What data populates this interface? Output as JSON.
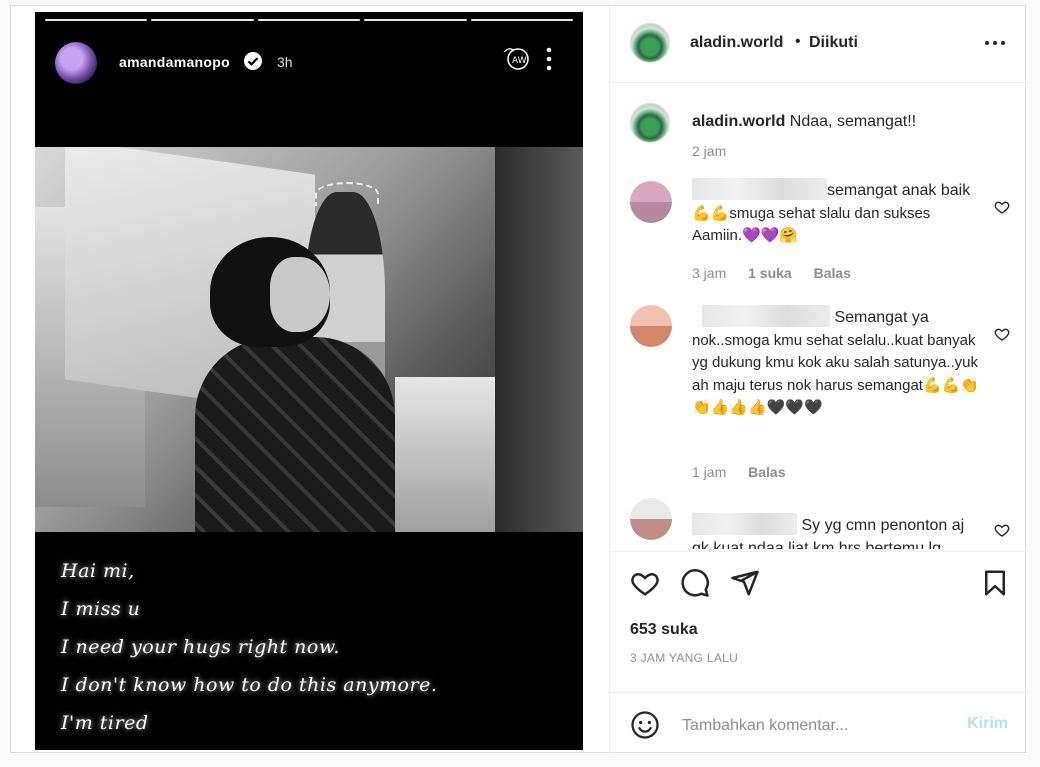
{
  "story": {
    "username": "amandamanopo",
    "time": "3h",
    "progress_segments": 5,
    "message_lines": [
      "Hai mi,",
      "I miss u",
      "I need your hugs right now.",
      "I don't know how to do this anymore.",
      "I'm tired"
    ]
  },
  "header": {
    "username": "aladin.world",
    "dot": "•",
    "follow_status": "Diikuti"
  },
  "caption": {
    "username": "aladin.world",
    "text": "Ndaa, semangat!!",
    "time": "2 jam"
  },
  "comments": [
    {
      "text_line1": "semangat anak baik",
      "text_rest": "💪💪smuga sehat slalu dan sukses Aamiin.💜💜🤗",
      "time": "3 jam",
      "likes": "1 suka",
      "reply": "Balas"
    },
    {
      "text_line1": "Semangat ya",
      "text_rest": "nok..smoga kmu sehat selalu..kuat banyak yg dukung kmu kok aku salah satunya..yuk ah maju terus nok harus semangat💪💪👏👏👍👍👍🖤🖤🖤",
      "time": "1 jam",
      "reply": "Balas"
    },
    {
      "text_line1": "Sy yg cmn penonton aj",
      "text_rest": "gk kuat ndaa liat km hrs bertemu lg"
    }
  ],
  "likes_count": "653 suka",
  "time_ago": "3 JAM YANG LALU",
  "composer": {
    "placeholder": "Tambahkan komentar...",
    "post_label": "Kirim"
  },
  "colors": {
    "link_disabled": "#b2dffc",
    "muted": "#8e8e8e",
    "border": "#dbdbdb"
  }
}
